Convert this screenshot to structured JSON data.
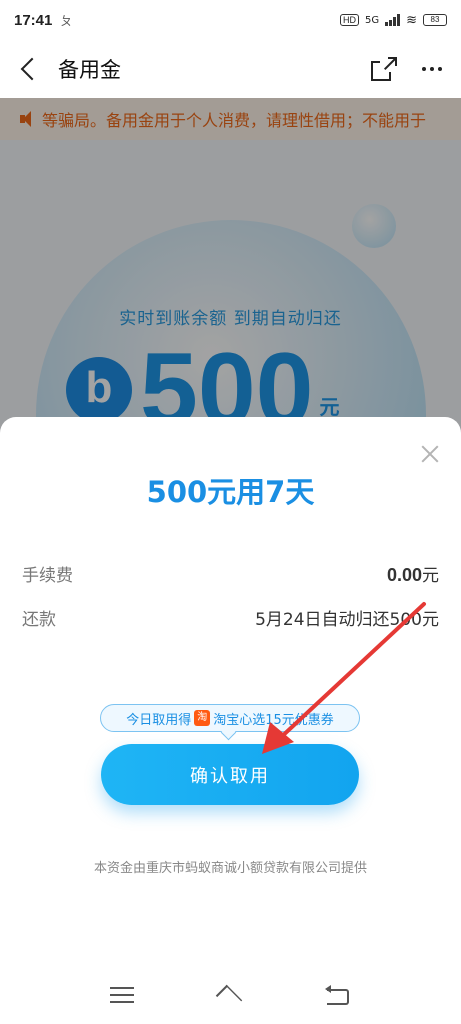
{
  "status_bar": {
    "time": "17:41",
    "extra": "ㄆ",
    "hd": "HD",
    "network": "5G",
    "battery": "83"
  },
  "header": {
    "title": "备用金",
    "icons": [
      "back-icon",
      "share-icon",
      "more-icon"
    ]
  },
  "background": {
    "notice": "等骗局。备用金用于个人消费，请理性借用；不能用于",
    "tagline": "实时到账余额 到期自动归还",
    "logo_letter": "b",
    "amount": "500",
    "unit": "元"
  },
  "sheet": {
    "title": "500元用7天",
    "fee_label": "手续费",
    "fee_amount": "0.00",
    "fee_unit": "元",
    "repay_label": "还款",
    "repay_value": "5月24日自动归还500元",
    "promo_prefix": "今日取用得",
    "promo_icon_text": "淘",
    "promo_suffix": "淘宝心选15元优惠券",
    "confirm_label": "确认取用",
    "footer": "本资金由重庆市蚂蚁商诚小额贷款有限公司提供"
  },
  "colors": {
    "accent": "#1a8fe3",
    "button": "#12a4ef",
    "notice": "#f06a1a",
    "annotation": "#e53935"
  }
}
